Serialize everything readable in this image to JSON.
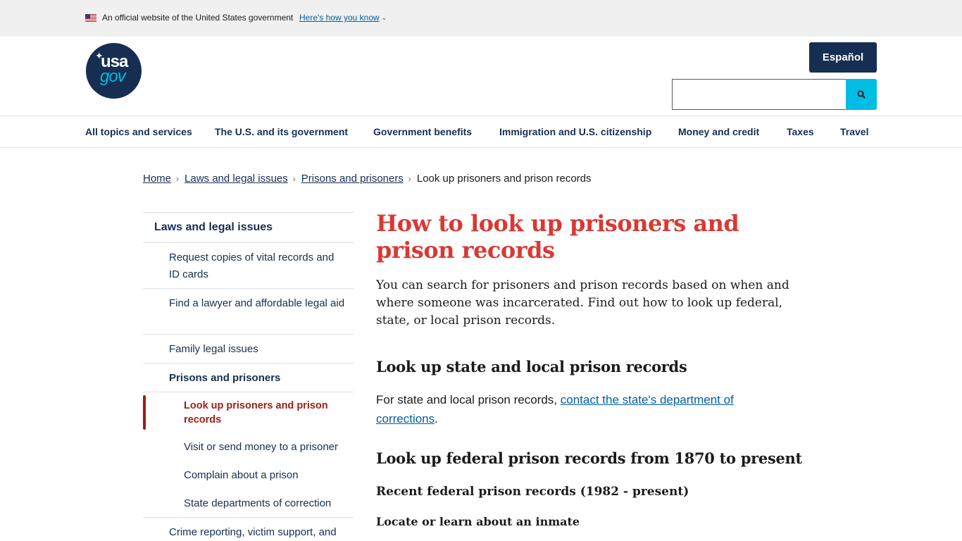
{
  "gov_banner": {
    "official_text": "An official website of the United States government",
    "how_link": "Here's how you know"
  },
  "header": {
    "logo_line1": "usa",
    "logo_line2": "gov",
    "espanol": "Español",
    "search_value": ""
  },
  "nav": [
    "All topics and services",
    "The U.S. and its government",
    "Government benefits",
    "Immigration and U.S. citizenship",
    "Money and credit",
    "Taxes",
    "Travel"
  ],
  "breadcrumb": {
    "home": "Home",
    "laws": "Laws and legal issues",
    "prisons": "Prisons and prisoners",
    "current": "Look up prisoners and prison records"
  },
  "sidenav": {
    "parent": "Laws and legal issues",
    "items": [
      "Request copies of vital records and ID cards",
      "Find a lawyer and affordable legal aid",
      "Family legal issues",
      "Prisons and prisoners",
      "Look up prisoners and prison records",
      "Visit or send money to a prisoner",
      "Complain about a prison",
      "State departments of correction",
      "Crime reporting, victim support, and"
    ]
  },
  "content": {
    "title": "How to look up prisoners and prison records",
    "intro": "You can search for prisoners and prison records based on when and where someone was incarcerated. Find out how to look up federal, state, or local prison records.",
    "h2_state": "Look up state and local prison records",
    "state_para_prefix": "For state and local prison records, ",
    "state_para_link": "contact the state's department of corrections",
    "state_para_suffix": ".",
    "h2_federal": "Look up federal prison records from 1870 to present",
    "h3_recent": "Recent federal prison records (1982 - present)",
    "h4_locate": "Locate or learn about an inmate"
  },
  "colors": {
    "navy": "#162e51",
    "cyan": "#00bde3",
    "title_red": "#d83933",
    "active_red": "#9c1d16",
    "link_blue": "#005ea2"
  }
}
